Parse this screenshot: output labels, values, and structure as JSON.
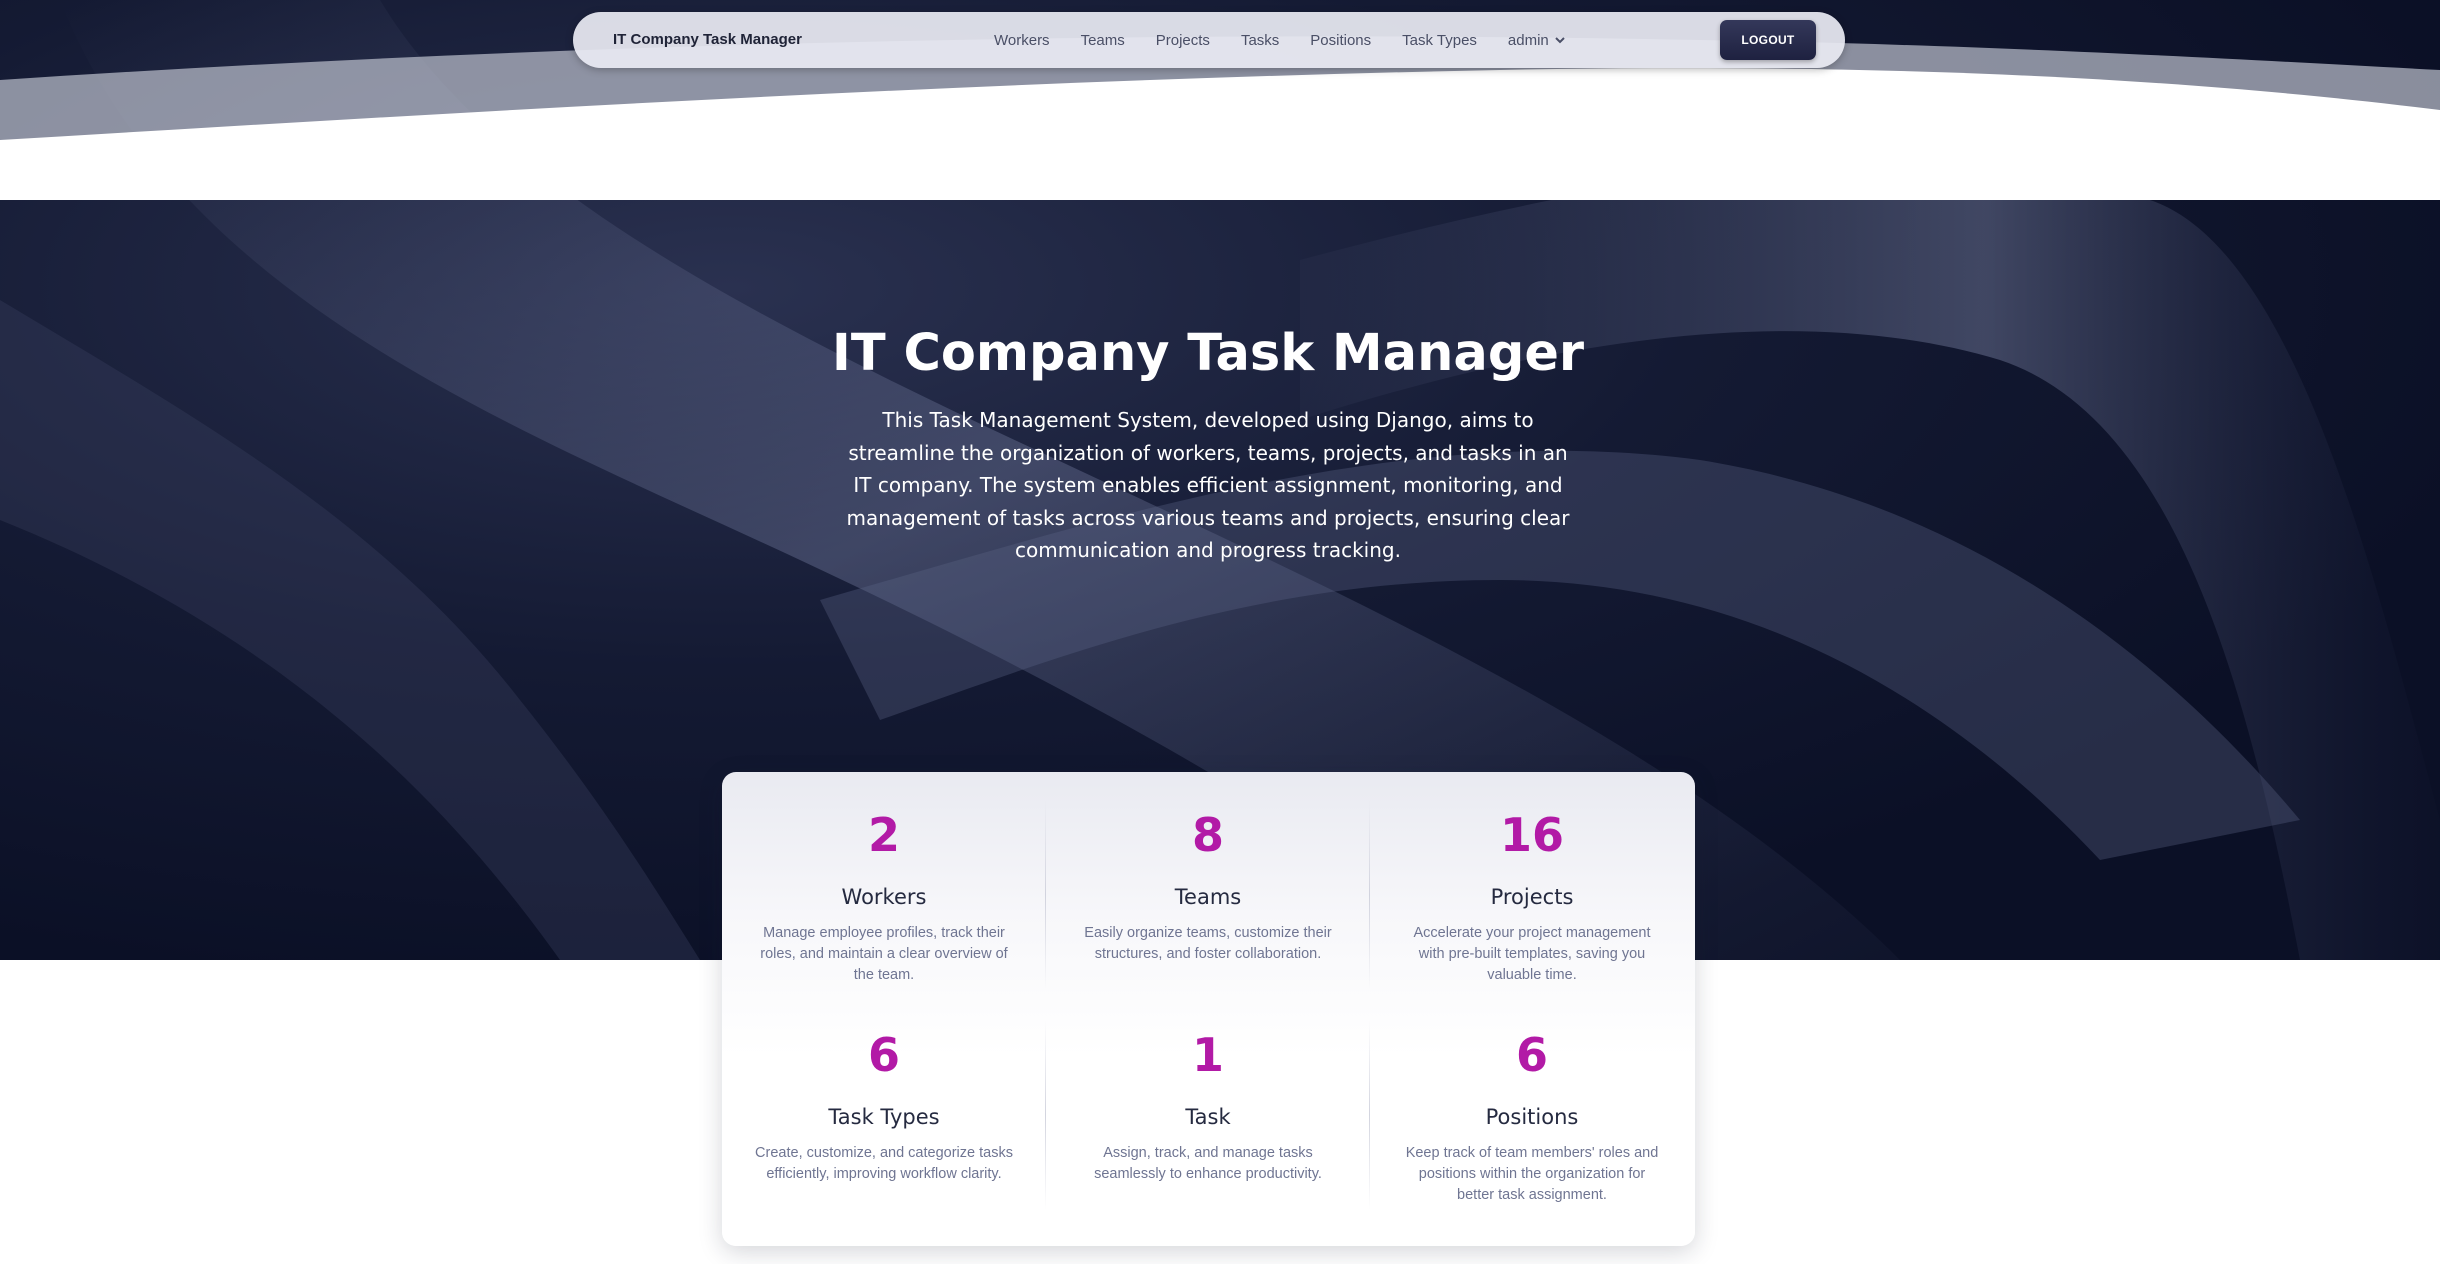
{
  "navbar": {
    "brand": "IT Company Task Manager",
    "links": [
      {
        "label": "Workers"
      },
      {
        "label": "Teams"
      },
      {
        "label": "Projects"
      },
      {
        "label": "Tasks"
      },
      {
        "label": "Positions"
      },
      {
        "label": "Task Types"
      }
    ],
    "user_menu": "admin",
    "logout_label": "LOGOUT"
  },
  "hero": {
    "title": "IT Company Task Manager",
    "description": "This Task Management System, developed using Django, aims to streamline the organization of workers, teams, projects, and tasks in an IT company. The system enables efficient assignment, monitoring, and management of tasks across various teams and projects, ensuring clear communication and progress tracking."
  },
  "stats": [
    {
      "value": "2",
      "label": "Workers",
      "description": "Manage employee profiles, track their roles, and maintain a clear overview of the team."
    },
    {
      "value": "8",
      "label": "Teams",
      "description": "Easily organize teams, customize their structures, and foster collaboration."
    },
    {
      "value": "16",
      "label": "Projects",
      "description": "Accelerate your project management with pre-built templates, saving you valuable time."
    },
    {
      "value": "6",
      "label": "Task Types",
      "description": "Create, customize, and categorize tasks efficiently, improving workflow clarity."
    },
    {
      "value": "1",
      "label": "Task",
      "description": "Assign, track, and manage tasks seamlessly to enhance productivity."
    },
    {
      "value": "6",
      "label": "Positions",
      "description": "Keep track of team members' roles and positions within the organization for better task assignment."
    }
  ],
  "colors": {
    "accent": "#b21aa6",
    "hero_bg": "#0b1026",
    "navbar_bg": "#e8eaf2",
    "button_bg": "#1e2140"
  }
}
